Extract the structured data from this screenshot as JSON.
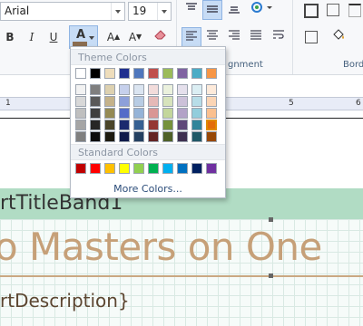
{
  "toolbar": {
    "font_name": "Arial",
    "font_size": "19",
    "bold": "B",
    "italic": "I",
    "underline": "U",
    "font_color_btn": "A",
    "grow_font": "A",
    "shrink_font": "A",
    "alignment_label": "gnment",
    "borders_label": "Bord"
  },
  "ruler": {
    "mark_1": "1",
    "mark_5": "5",
    "mark_6": "6"
  },
  "report": {
    "band_label": "rtTitleBand1",
    "title_text": "o Masters on One",
    "description_text": "rtDescription}"
  },
  "color_picker": {
    "theme_header": "Theme Colors",
    "standard_header": "Standard Colors",
    "more_colors": "More Colors...",
    "theme_top": [
      "#ffffff",
      "#000000",
      "#eeddbb",
      "#1f2f8f",
      "#4f77bd",
      "#c0504d",
      "#9bbb59",
      "#8064a2",
      "#4bacc6",
      "#f79646"
    ],
    "theme_shades": [
      [
        "#f2f2f2",
        "#7f7f7f",
        "#ddd1b0",
        "#c6d0ec",
        "#dbe5f1",
        "#f2dcdb",
        "#ebf1dd",
        "#e5e0ec",
        "#dbeef3",
        "#fdeada"
      ],
      [
        "#d8d8d8",
        "#595959",
        "#c4b28a",
        "#8da0da",
        "#b8cce4",
        "#e5b9b7",
        "#d7e3bc",
        "#ccc1d9",
        "#b7dde8",
        "#fbd5b5"
      ],
      [
        "#bfbfbf",
        "#3f3f3f",
        "#948a54",
        "#546cc8",
        "#95b3d7",
        "#d99694",
        "#c3d69b",
        "#b2a2c7",
        "#92cddc",
        "#fac08f"
      ],
      [
        "#a5a5a5",
        "#262626",
        "#4a452a",
        "#1b2a6e",
        "#366092",
        "#953734",
        "#76923c",
        "#5f497a",
        "#31859b",
        "#e36c09"
      ],
      [
        "#7f7f7f",
        "#0c0c0c",
        "#1d1b10",
        "#0f1a4a",
        "#244061",
        "#632423",
        "#4f6128",
        "#3f3151",
        "#205867",
        "#974806"
      ]
    ],
    "standard": [
      "#c00000",
      "#ff0000",
      "#ffc000",
      "#ffff00",
      "#92d050",
      "#00b050",
      "#00b0f0",
      "#0070c0",
      "#002060",
      "#7030a0"
    ],
    "selected_color": "#f79646"
  }
}
